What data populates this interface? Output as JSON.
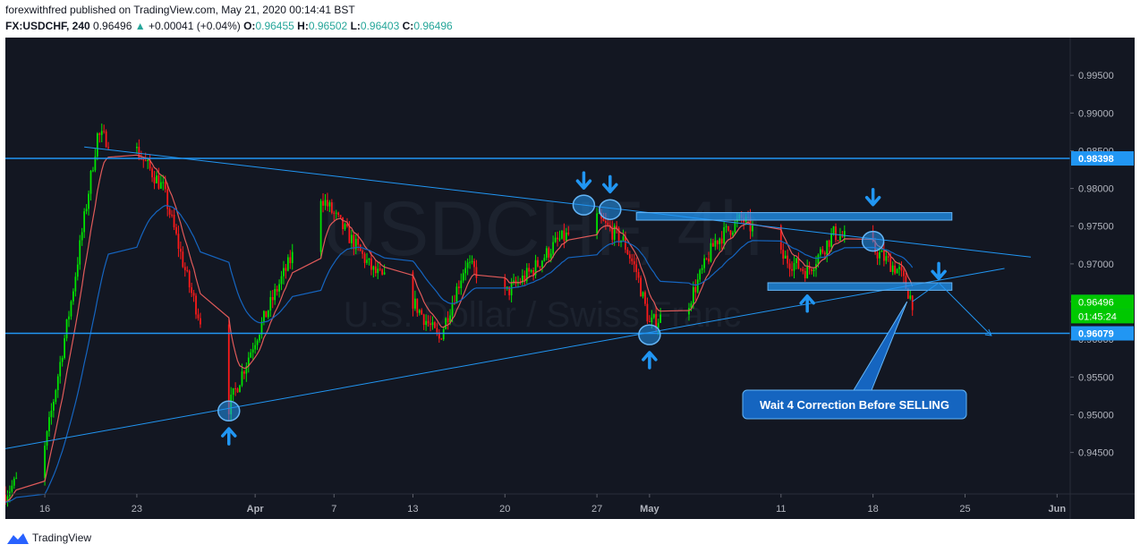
{
  "header": {
    "line1": "forexwithfred published on TradingView.com, May 21, 2020 00:14:41 BST",
    "symbol": "FX:USDCHF, 240",
    "price": "0.96496",
    "change_arrow": "▲",
    "change": "+0.00041 (+0.04%)",
    "o_label": "O:",
    "o": "0.96455",
    "h_label": "H:",
    "h": "0.96502",
    "l_label": "L:",
    "l": "0.96403",
    "c_label": "C:",
    "c": "0.96496"
  },
  "watermark": {
    "ticker": "USDCHF, 4h",
    "name": "U.S. Dollar / Swiss Franc"
  },
  "annotation": "Wait 4 Correction Before SELLING",
  "footer": {
    "brand": "TradingView"
  },
  "colors": {
    "background": "#131722",
    "up": "#00e600",
    "down": "#ff1a1a",
    "drawing": "#2196f3",
    "ema_fast": "#e05a5a",
    "ema_slow": "#1565c0",
    "axis_text": "#b2b5be"
  },
  "chart_data": {
    "type": "candlestick",
    "y_ticks": [
      "0.94500",
      "0.95000",
      "0.95500",
      "0.96000",
      "0.96500",
      "0.97000",
      "0.97500",
      "0.98000",
      "0.98500",
      "0.99000",
      "0.99500"
    ],
    "ylim": [
      0.9395,
      1.0
    ],
    "x_ticks": [
      "16",
      "23",
      "Apr",
      "7",
      "13",
      "20",
      "27",
      "May",
      "11",
      "18",
      "25",
      "Jun"
    ],
    "x_tick_dates": [
      "2020-03-16",
      "2020-03-23",
      "2020-04-01",
      "2020-04-07",
      "2020-04-13",
      "2020-04-20",
      "2020-04-27",
      "2020-05-01",
      "2020-05-11",
      "2020-05-18",
      "2020-05-25",
      "2020-06-01"
    ],
    "price_labels": [
      {
        "value": 0.98398,
        "text": "0.98398"
      },
      {
        "value": 0.96496,
        "text": "0.96496"
      },
      {
        "value": 0.96079,
        "text": "0.96079"
      }
    ],
    "countdown": "01:45:24",
    "horizontal_lines": [
      0.98398,
      0.96079
    ],
    "swing_path": [
      [
        "2020-03-13",
        0.9395
      ],
      [
        "2020-03-16",
        0.9455
      ],
      [
        "2020-03-18",
        0.965
      ],
      [
        "2020-03-20",
        0.987
      ],
      [
        "2020-03-23",
        0.985
      ],
      [
        "2020-03-25",
        0.98
      ],
      [
        "2020-03-27",
        0.967
      ],
      [
        "2020-03-30",
        0.951
      ],
      [
        "2020-04-01",
        0.96
      ],
      [
        "2020-04-03",
        0.968
      ],
      [
        "2020-04-06",
        0.979
      ],
      [
        "2020-04-08",
        0.974
      ],
      [
        "2020-04-10",
        0.969
      ],
      [
        "2020-04-13",
        0.965
      ],
      [
        "2020-04-15",
        0.96
      ],
      [
        "2020-04-17",
        0.97
      ],
      [
        "2020-04-20",
        0.966
      ],
      [
        "2020-04-22",
        0.969
      ],
      [
        "2020-04-24",
        0.973
      ],
      [
        "2020-04-27",
        0.976
      ],
      [
        "2020-04-29",
        0.973
      ],
      [
        "2020-04-30",
        0.969
      ],
      [
        "2020-05-01",
        0.962
      ],
      [
        "2020-05-04",
        0.965
      ],
      [
        "2020-05-06",
        0.973
      ],
      [
        "2020-05-08",
        0.976
      ],
      [
        "2020-05-11",
        0.971
      ],
      [
        "2020-05-13",
        0.969
      ],
      [
        "2020-05-15",
        0.974
      ],
      [
        "2020-05-18",
        0.972
      ],
      [
        "2020-05-20",
        0.969
      ],
      [
        "2020-05-21",
        0.96496
      ]
    ],
    "trendlines": [
      {
        "from": [
          "2020-03-19",
          0.9855
        ],
        "to": [
          "2020-05-30",
          0.9709
        ]
      },
      {
        "from": [
          "2020-03-13",
          0.9455
        ],
        "to": [
          "2020-05-28",
          0.9694
        ]
      }
    ],
    "zones": [
      {
        "x0": "2020-04-30",
        "x1": "2020-05-24",
        "y0": 0.9758,
        "y1": 0.9768
      },
      {
        "x0": "2020-05-10",
        "x1": "2020-05-24",
        "y0": 0.9665,
        "y1": 0.9675
      }
    ],
    "circles": [
      {
        "date": "2020-03-30",
        "value": 0.9505
      },
      {
        "date": "2020-04-26",
        "value": 0.9778
      },
      {
        "date": "2020-04-28",
        "value": 0.9772
      },
      {
        "date": "2020-05-01",
        "value": 0.9606
      },
      {
        "date": "2020-05-18",
        "value": 0.973
      }
    ],
    "arrows_down": [
      {
        "date": "2020-04-26",
        "value": 0.981
      },
      {
        "date": "2020-04-28",
        "value": 0.9805
      },
      {
        "date": "2020-05-18",
        "value": 0.9788
      },
      {
        "date": "2020-05-23",
        "value": 0.969
      }
    ],
    "arrows_up": [
      {
        "date": "2020-03-30",
        "value": 0.9472
      },
      {
        "date": "2020-05-01",
        "value": 0.9573
      },
      {
        "date": "2020-05-13",
        "value": 0.9648
      }
    ],
    "projection": [
      [
        "2020-05-21",
        0.965
      ],
      [
        "2020-05-23",
        0.9675
      ],
      [
        "2020-05-27",
        0.9605
      ]
    ]
  }
}
